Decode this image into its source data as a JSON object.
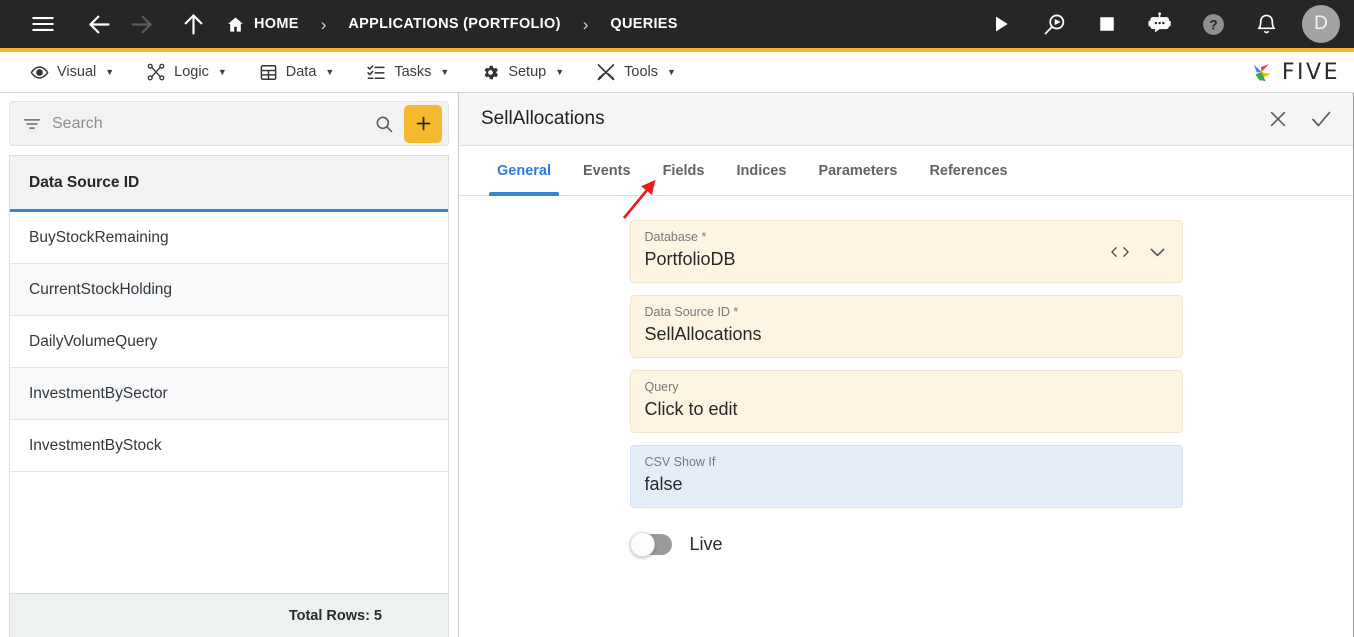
{
  "topbar": {
    "menu_icon": "hamburger-icon",
    "back_icon": "arrow-left-icon",
    "forward_icon": "arrow-right-icon",
    "up_icon": "arrow-up-icon",
    "breadcrumbs": [
      {
        "label": "HOME",
        "icon": "home-icon"
      },
      {
        "label": "APPLICATIONS (PORTFOLIO)",
        "icon": ""
      },
      {
        "label": "QUERIES",
        "icon": ""
      }
    ],
    "separator": "›",
    "actions": [
      {
        "name": "run-button",
        "icon": "play-icon"
      },
      {
        "name": "debug-button",
        "icon": "search-play-icon"
      },
      {
        "name": "stop-button",
        "icon": "stop-square-icon"
      },
      {
        "name": "assistant-button",
        "icon": "chat-bot-icon"
      },
      {
        "name": "help-button",
        "icon": "question-circle-icon"
      },
      {
        "name": "notifications-button",
        "icon": "bell-icon"
      }
    ],
    "avatar_initial": "D",
    "accent_gold": "#f0b429",
    "background": "#262626"
  },
  "menubar": {
    "items": [
      {
        "label": "Visual",
        "icon": "eye-icon"
      },
      {
        "label": "Logic",
        "icon": "nodes-icon"
      },
      {
        "label": "Data",
        "icon": "table-icon"
      },
      {
        "label": "Tasks",
        "icon": "checklist-icon"
      },
      {
        "label": "Setup",
        "icon": "gear-icon"
      },
      {
        "label": "Tools",
        "icon": "tools-icon"
      }
    ],
    "caret": "▼",
    "brand": "FIVE"
  },
  "sidebar": {
    "search": {
      "placeholder": "Search",
      "value": ""
    },
    "filter_icon": "filter-icon",
    "search_icon": "search-icon",
    "add_label": "+",
    "column_header": "Data Source ID",
    "rows": [
      "BuyStockRemaining",
      "CurrentStockHolding",
      "DailyVolumeQuery",
      "InvestmentBySector",
      "InvestmentByStock"
    ],
    "footer": "Total Rows: 5"
  },
  "detail": {
    "title": "SellAllocations",
    "close_icon": "close-icon",
    "confirm_icon": "check-icon",
    "tabs": [
      {
        "label": "General",
        "active": true
      },
      {
        "label": "Events",
        "active": false
      },
      {
        "label": "Fields",
        "active": false
      },
      {
        "label": "Indices",
        "active": false
      },
      {
        "label": "Parameters",
        "active": false
      },
      {
        "label": "References",
        "active": false
      }
    ],
    "fields": [
      {
        "label": "Database *",
        "value": "PortfolioDB",
        "tone": "cream",
        "actions": [
          "code-icon",
          "chevron-down-icon"
        ]
      },
      {
        "label": "Data Source ID *",
        "value": "SellAllocations",
        "tone": "cream",
        "actions": []
      },
      {
        "label": "Query",
        "value": "Click to edit",
        "tone": "cream",
        "actions": []
      },
      {
        "label": "CSV Show If",
        "value": "false",
        "tone": "blue",
        "actions": []
      }
    ],
    "toggle": {
      "label": "Live",
      "on": false
    }
  },
  "annotation": {
    "color": "#ef1b1b",
    "target": "Fields"
  }
}
